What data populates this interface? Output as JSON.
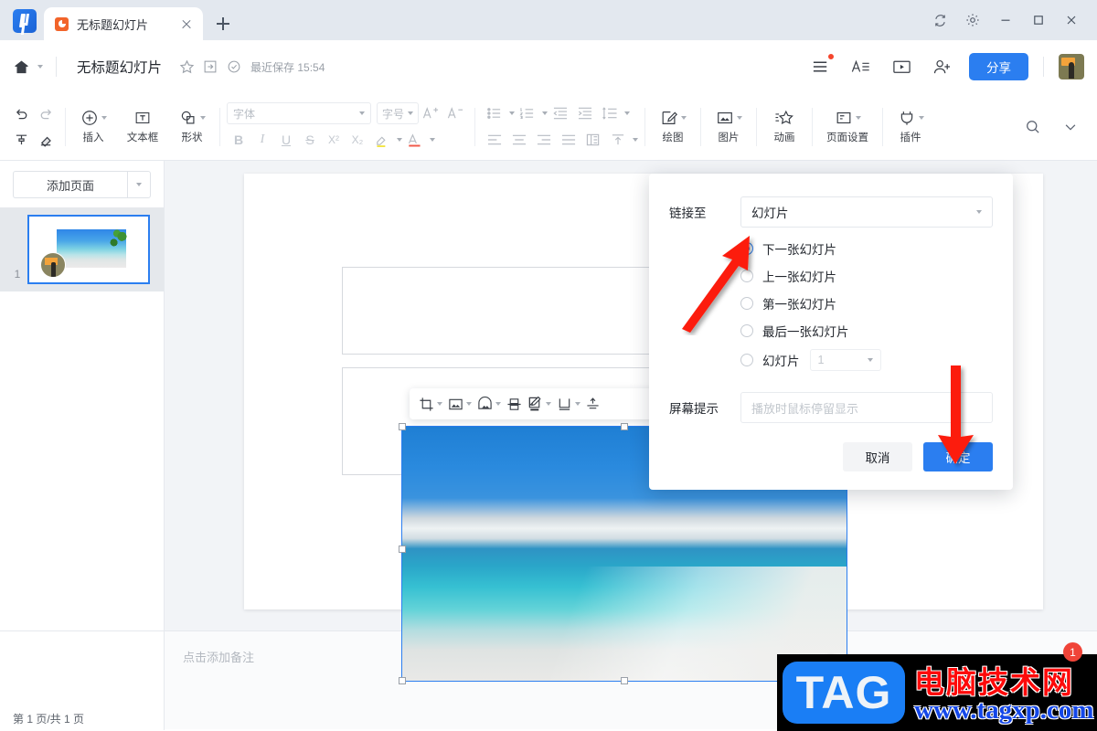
{
  "window": {
    "tab_title": "无标题幻灯片",
    "controls": {
      "refresh": "refresh-icon",
      "settings": "gear-icon",
      "minimize": "—",
      "maximize": "□",
      "close": "✕"
    }
  },
  "header": {
    "doc_title": "无标题幻灯片",
    "saved_status": "最近保存 15:54",
    "share_label": "分享"
  },
  "ribbon": {
    "insert_label": "插入",
    "textbox_label": "文本框",
    "shape_label": "形状",
    "font_placeholder": "字体",
    "fontsize_placeholder": "字号",
    "grow_font": "A",
    "shrink_font": "A",
    "bold": "B",
    "italic": "I",
    "underline": "U",
    "strike": "S",
    "superscript": "X²",
    "subscript": "X₂",
    "draw_label": "绘图",
    "picture_label": "图片",
    "animation_label": "动画",
    "pagesetup_label": "页面设置",
    "plugin_label": "插件"
  },
  "sidebar": {
    "add_page_label": "添加页面",
    "slides": [
      {
        "number": "1"
      }
    ]
  },
  "notes": {
    "placeholder": "点击添加备注"
  },
  "status": {
    "page_info": "第 1 页/共 1 页"
  },
  "dialog": {
    "link_to_label": "链接至",
    "link_to_value": "幻灯片",
    "options": [
      {
        "label": "下一张幻灯片",
        "selected": true
      },
      {
        "label": "上一张幻灯片",
        "selected": false
      },
      {
        "label": "第一张幻灯片",
        "selected": false
      },
      {
        "label": "最后一张幻灯片",
        "selected": false
      },
      {
        "label": "幻灯片",
        "selected": false,
        "number_value": "1"
      }
    ],
    "tooltip_label": "屏幕提示",
    "tooltip_placeholder": "播放时鼠标停留显示",
    "cancel_label": "取消",
    "confirm_label": "确定"
  },
  "watermark": {
    "tag": "TAG",
    "site_name": "电脑技术网",
    "url": "www.tagxp.com",
    "badge_count": "1"
  },
  "colors": {
    "accent": "#2b7ef0",
    "arrow_red": "#fc1c0a",
    "tabbar_bg": "#e3e8ef",
    "canvas_bg": "#f2f4f7"
  }
}
